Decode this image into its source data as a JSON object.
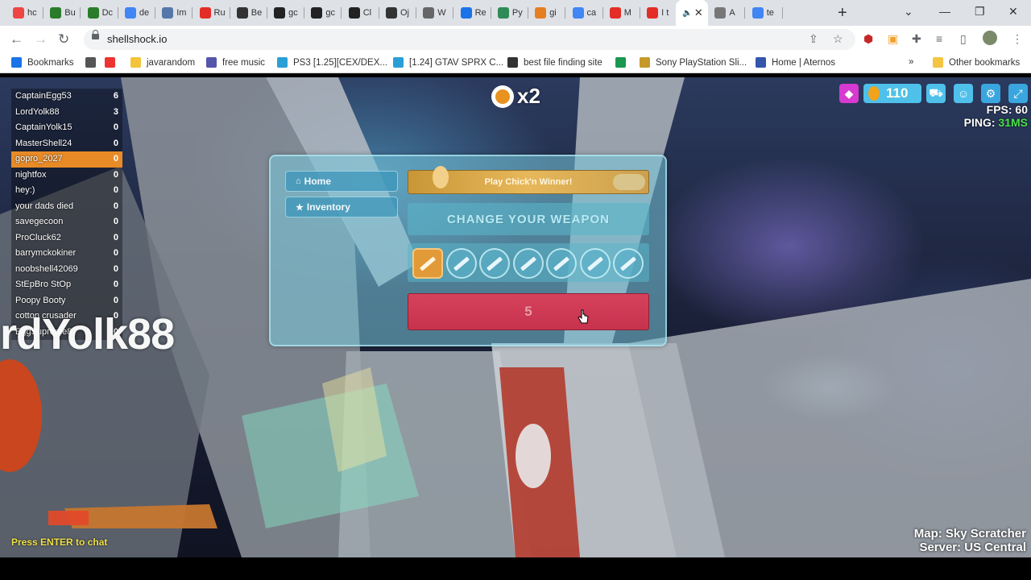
{
  "browser": {
    "tabs": [
      {
        "title": "hc",
        "color": "#e44"
      },
      {
        "title": "Bu",
        "color": "#2a7c2a"
      },
      {
        "title": "Dc",
        "color": "#2a7c2a"
      },
      {
        "title": "de",
        "color": "#4285f4"
      },
      {
        "title": "Im",
        "color": "#5577aa"
      },
      {
        "title": "Ru",
        "color": "#e52d27"
      },
      {
        "title": "Be",
        "color": "#333"
      },
      {
        "title": "gc",
        "color": "#222"
      },
      {
        "title": "gc",
        "color": "#222"
      },
      {
        "title": "Cl",
        "color": "#222"
      },
      {
        "title": "Oj",
        "color": "#333"
      },
      {
        "title": "W",
        "color": "#666"
      },
      {
        "title": "Re",
        "color": "#1a73e8"
      },
      {
        "title": "Py",
        "color": "#2e8b57"
      },
      {
        "title": "gi",
        "color": "#e67e22"
      },
      {
        "title": "ca",
        "color": "#4285f4"
      },
      {
        "title": "M",
        "color": "#e52d27"
      },
      {
        "title": "I t",
        "color": "#e52d27"
      }
    ],
    "active_tab_close": "✕",
    "tabs_after": [
      {
        "title": "A",
        "color": "#777"
      },
      {
        "title": "te",
        "color": "#4285f4"
      }
    ],
    "new_tab": "+",
    "url": "shellshock.io",
    "bookmarks_bar": [
      {
        "label": "Bookmarks",
        "color": "#1a73e8"
      },
      {
        "label": "",
        "color": "#555"
      },
      {
        "label": "",
        "color": "#e33"
      },
      {
        "label": "javarandom",
        "color": "#f2c33b"
      },
      {
        "label": "free music",
        "color": "#5555aa"
      },
      {
        "label": "PS3 [1.25][CEX/DEX...",
        "color": "#2a9fd6"
      },
      {
        "label": "[1.24] GTAV SPRX C...",
        "color": "#2a9fd6"
      },
      {
        "label": "best file finding site",
        "color": "#333"
      },
      {
        "label": "",
        "color": "#1a9850"
      },
      {
        "label": "Sony PlayStation Sli...",
        "color": "#c59a2a"
      },
      {
        "label": "Home | Aternos",
        "color": "#3355aa"
      }
    ],
    "other_bookmarks": "Other bookmarks"
  },
  "game": {
    "scoreboard": [
      {
        "name": "CaptainEgg53",
        "score": "6"
      },
      {
        "name": "LordYolk88",
        "score": "3"
      },
      {
        "name": "CaptainYolk15",
        "score": "0"
      },
      {
        "name": "MasterShell24",
        "score": "0"
      },
      {
        "name": "gopro_2027",
        "score": "0",
        "me": true
      },
      {
        "name": "nightfox",
        "score": "0"
      },
      {
        "name": "hey:)",
        "score": "0"
      },
      {
        "name": "your dads died",
        "score": "0"
      },
      {
        "name": "savegecoon",
        "score": "0"
      },
      {
        "name": "ProCluck62",
        "score": "0"
      },
      {
        "name": "barrymckokiner",
        "score": "0"
      },
      {
        "name": "noobshell42069",
        "score": "0"
      },
      {
        "name": "StEpBro StOp",
        "score": "0"
      },
      {
        "name": "Poopy Booty",
        "score": "0"
      },
      {
        "name": "cotton crusader",
        "score": "0"
      },
      {
        "name": "EggSupreme8",
        "score": "0"
      }
    ],
    "killer_name": "rdYolk88",
    "streak": "x2",
    "eggs": "110",
    "fps_label": "FPS:",
    "fps_value": "60",
    "ping_label": "PING:",
    "ping_value": "31MS",
    "menu": {
      "home": "Home",
      "inventory": "Inventory",
      "chick_winner": "Play Chick'n Winner!",
      "change_weapon": "CHANGE YOUR WEAPON",
      "weapon_count": 7,
      "selected_weapon_index": 0,
      "respawn_countdown": "5"
    },
    "chat_prompt": "Press ENTER to chat",
    "map_label": "Map: Sky Scratcher",
    "server_label": "Server: US Central"
  },
  "colors": {
    "accent_orange": "#e88b27",
    "panel_teal": "#78c8dc",
    "play_red": "#d6415c",
    "ping_green": "#4be34b",
    "chat_yellow": "#f0e14a"
  }
}
